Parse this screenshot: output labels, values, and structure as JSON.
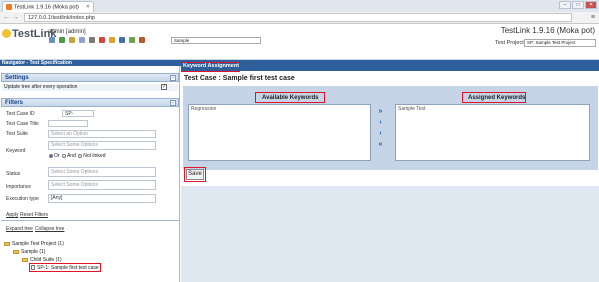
{
  "browser": {
    "tab_title": "TestLink 1.9.16 (Moka pot)",
    "url": "127.0.0.1/testlink/index.php",
    "window_buttons": [
      "–",
      "□",
      "✕"
    ]
  },
  "header": {
    "logo": "TestLink",
    "user": "admin [admin]",
    "version": "TestLink 1.9.16 (Moka pot)",
    "test_project_label": "Test Project",
    "test_project_value": "SP: Sample Test Project",
    "toolbar_select": "Sample"
  },
  "navigator": {
    "title": "Navigator - Test Specification"
  },
  "settings": {
    "title": "Settings",
    "update_tree_label": "Update tree after every operation",
    "update_tree_checked": "✓"
  },
  "filters": {
    "title": "Filters",
    "test_case_id_label": "Test Case ID",
    "test_case_id_value": "SP-",
    "test_case_title_label": "Test Case Title",
    "test_suite_label": "Test Suite",
    "test_suite_placeholder": "Select an Option",
    "keyword_label": "Keyword",
    "keyword_placeholder": "Select Some Options",
    "keyword_or": "Or",
    "keyword_and": "And",
    "keyword_not_linked": "Not linked",
    "status_label": "Status",
    "status_placeholder": "Select Some Options",
    "importance_label": "Importance",
    "importance_placeholder": "Select Some Options",
    "execution_type_label": "Execution type",
    "execution_type_value": "[Any]",
    "apply_button": "Apply",
    "reset_button": "Reset Filters"
  },
  "tree_actions": {
    "expand": "Expand tree",
    "collapse": "Collapse tree"
  },
  "tree": [
    "Sample Test Project (1)",
    "Sample (1)",
    "Child Suite (1)",
    "SP-1: Sample first test case"
  ],
  "main": {
    "title": "Keyword Assignment",
    "test_case_line": "Test Case : Sample first test case",
    "available_header": "Available Keywords",
    "assigned_header": "Assigned Keywords",
    "available_keywords": [
      "Regression"
    ],
    "assigned_keywords": [
      "Sample Test"
    ],
    "move_arrows": [
      "»",
      "›",
      "‹",
      "«"
    ],
    "save_button": "Save"
  },
  "colors": {
    "nav_blue": "#2f5f9a",
    "panel_blue": "#c5d5e7",
    "highlight_red": "#e0142b",
    "selection_blue": "#3b78c8"
  }
}
